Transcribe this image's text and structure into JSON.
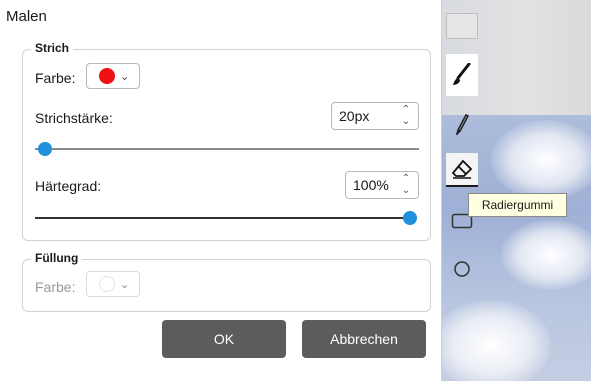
{
  "dialog": {
    "title": "Malen",
    "stroke": {
      "legend": "Strich",
      "color_label": "Farbe:",
      "color": "#ee1111",
      "width_label": "Strichstärke:",
      "width_value": "20px",
      "width_slider_fraction": 0.05,
      "hardness_label": "Härtegrad:",
      "hardness_value": "100%",
      "hardness_slider_fraction": 1.0
    },
    "fill": {
      "legend": "Füllung",
      "color_label": "Farbe:",
      "enabled": false
    },
    "ok_label": "OK",
    "cancel_label": "Abbrechen"
  },
  "palette": {
    "tools": [
      "color-swatch",
      "brush-icon",
      "pencil-icon",
      "eraser-icon",
      "rectangle-icon",
      "circle-icon"
    ],
    "selected": "eraser-icon"
  },
  "tooltip": {
    "text": "Radiergummi"
  }
}
